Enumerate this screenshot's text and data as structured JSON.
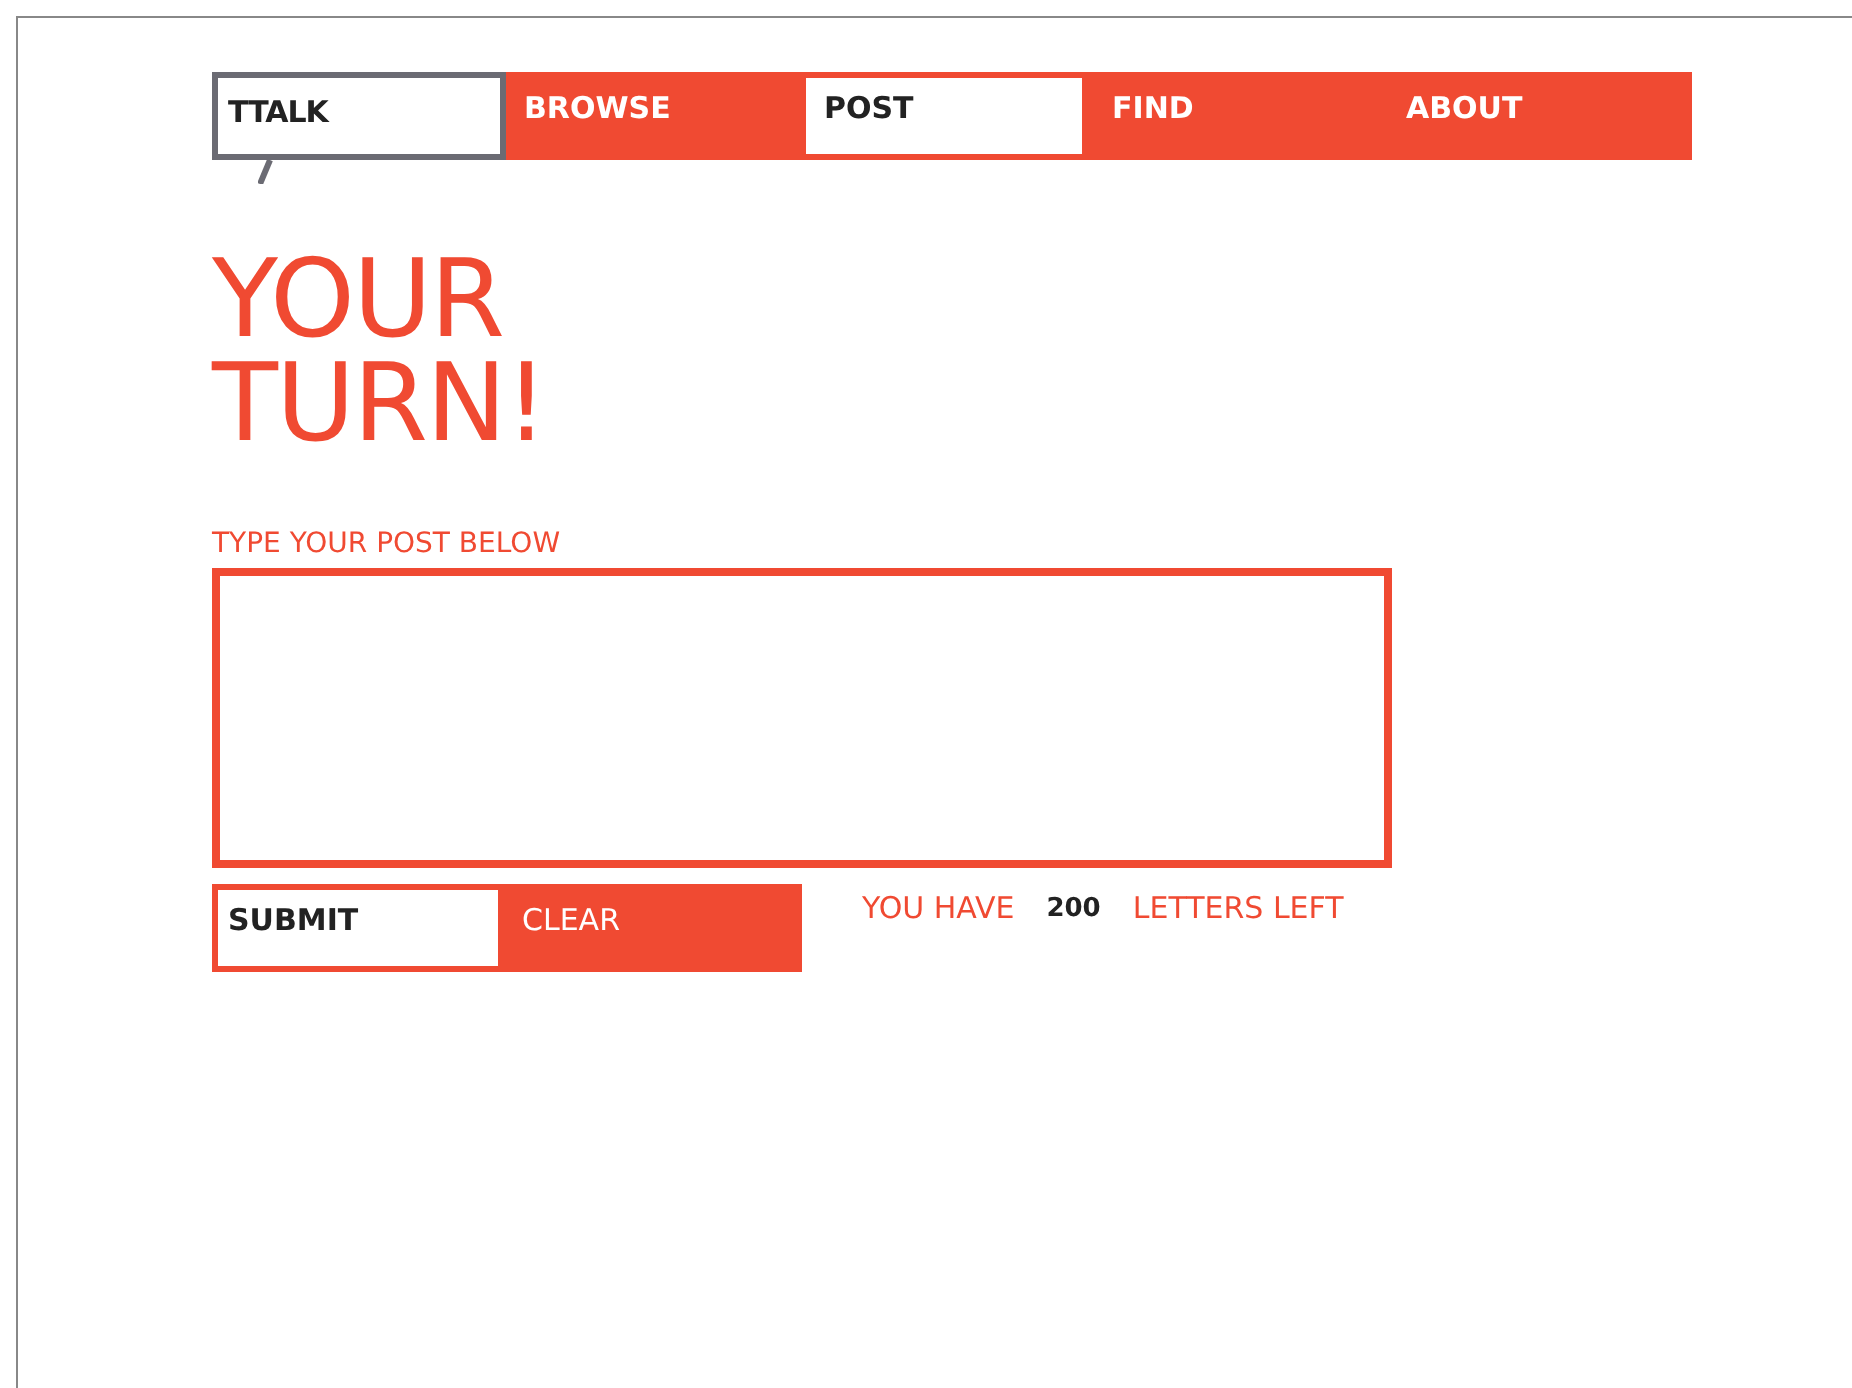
{
  "logo": "TTALK",
  "nav": [
    {
      "label": "BROWSE",
      "selected": false
    },
    {
      "label": "POST",
      "selected": true
    },
    {
      "label": "FIND",
      "selected": false
    },
    {
      "label": "ABOUT",
      "selected": false
    }
  ],
  "heading": [
    "YOUR",
    "TURN!"
  ],
  "post_field": {
    "label": "TYPE YOUR POST BELOW"
  },
  "buttons": [
    {
      "label": "SUBMIT",
      "kind": "primary"
    },
    {
      "label": "CLEAR",
      "kind": "secondary"
    }
  ],
  "counter": {
    "prefix": "YOU HAVE",
    "count": "200",
    "suffix": "LETTERS LEFT"
  }
}
